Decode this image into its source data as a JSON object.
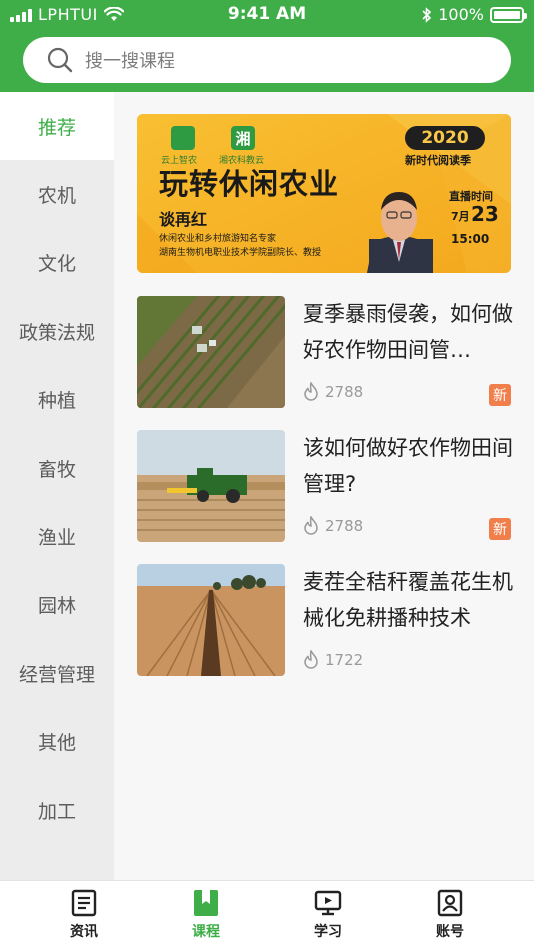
{
  "status_bar": {
    "carrier": "LPHTUI",
    "time": "9:41 AM",
    "battery": "100%"
  },
  "search": {
    "placeholder": "搜一搜课程",
    "icon": "search-icon"
  },
  "sidebar": {
    "items": [
      {
        "label": "推荐",
        "active": true
      },
      {
        "label": "农机"
      },
      {
        "label": "文化"
      },
      {
        "label": "政策法规"
      },
      {
        "label": "种植"
      },
      {
        "label": "畜牧"
      },
      {
        "label": "渔业"
      },
      {
        "label": "园林"
      },
      {
        "label": "经营管理"
      },
      {
        "label": "其他"
      },
      {
        "label": "加工"
      }
    ]
  },
  "banner": {
    "logo1": "云上智农",
    "logo2": "湘农科教云",
    "logo2_char": "湘",
    "title": "玩转休闲农业",
    "badge_year": "2020",
    "badge_sub": "新时代阅读季",
    "speaker": "谈再红",
    "desc1": "休闲农业和乡村旅游知名专家",
    "desc2": "湖南生物机电职业技术学院副院长、教授",
    "live_label": "直播时间",
    "month": "7月",
    "day": "23",
    "time": "15:00"
  },
  "courses": [
    {
      "title": "夏季暴雨侵袭，如何做好农作物田间管…",
      "views": "2788",
      "badge": "新"
    },
    {
      "title": "该如何做好农作物田间管理?",
      "views": "2788",
      "badge": "新"
    },
    {
      "title": "麦茬全秸秆覆盖花生机械化免耕播种技术",
      "views": "1722",
      "badge": ""
    }
  ],
  "tabbar": {
    "tabs": [
      {
        "label": "资讯",
        "icon": "news-icon"
      },
      {
        "label": "课程",
        "icon": "bookmark-icon",
        "active": true
      },
      {
        "label": "学习",
        "icon": "video-play-icon"
      },
      {
        "label": "账号",
        "icon": "account-icon"
      }
    ]
  },
  "colors": {
    "brand_green": "#3fae49",
    "badge_orange": "#f07f4c",
    "banner_yellow": "#f7b52a"
  }
}
